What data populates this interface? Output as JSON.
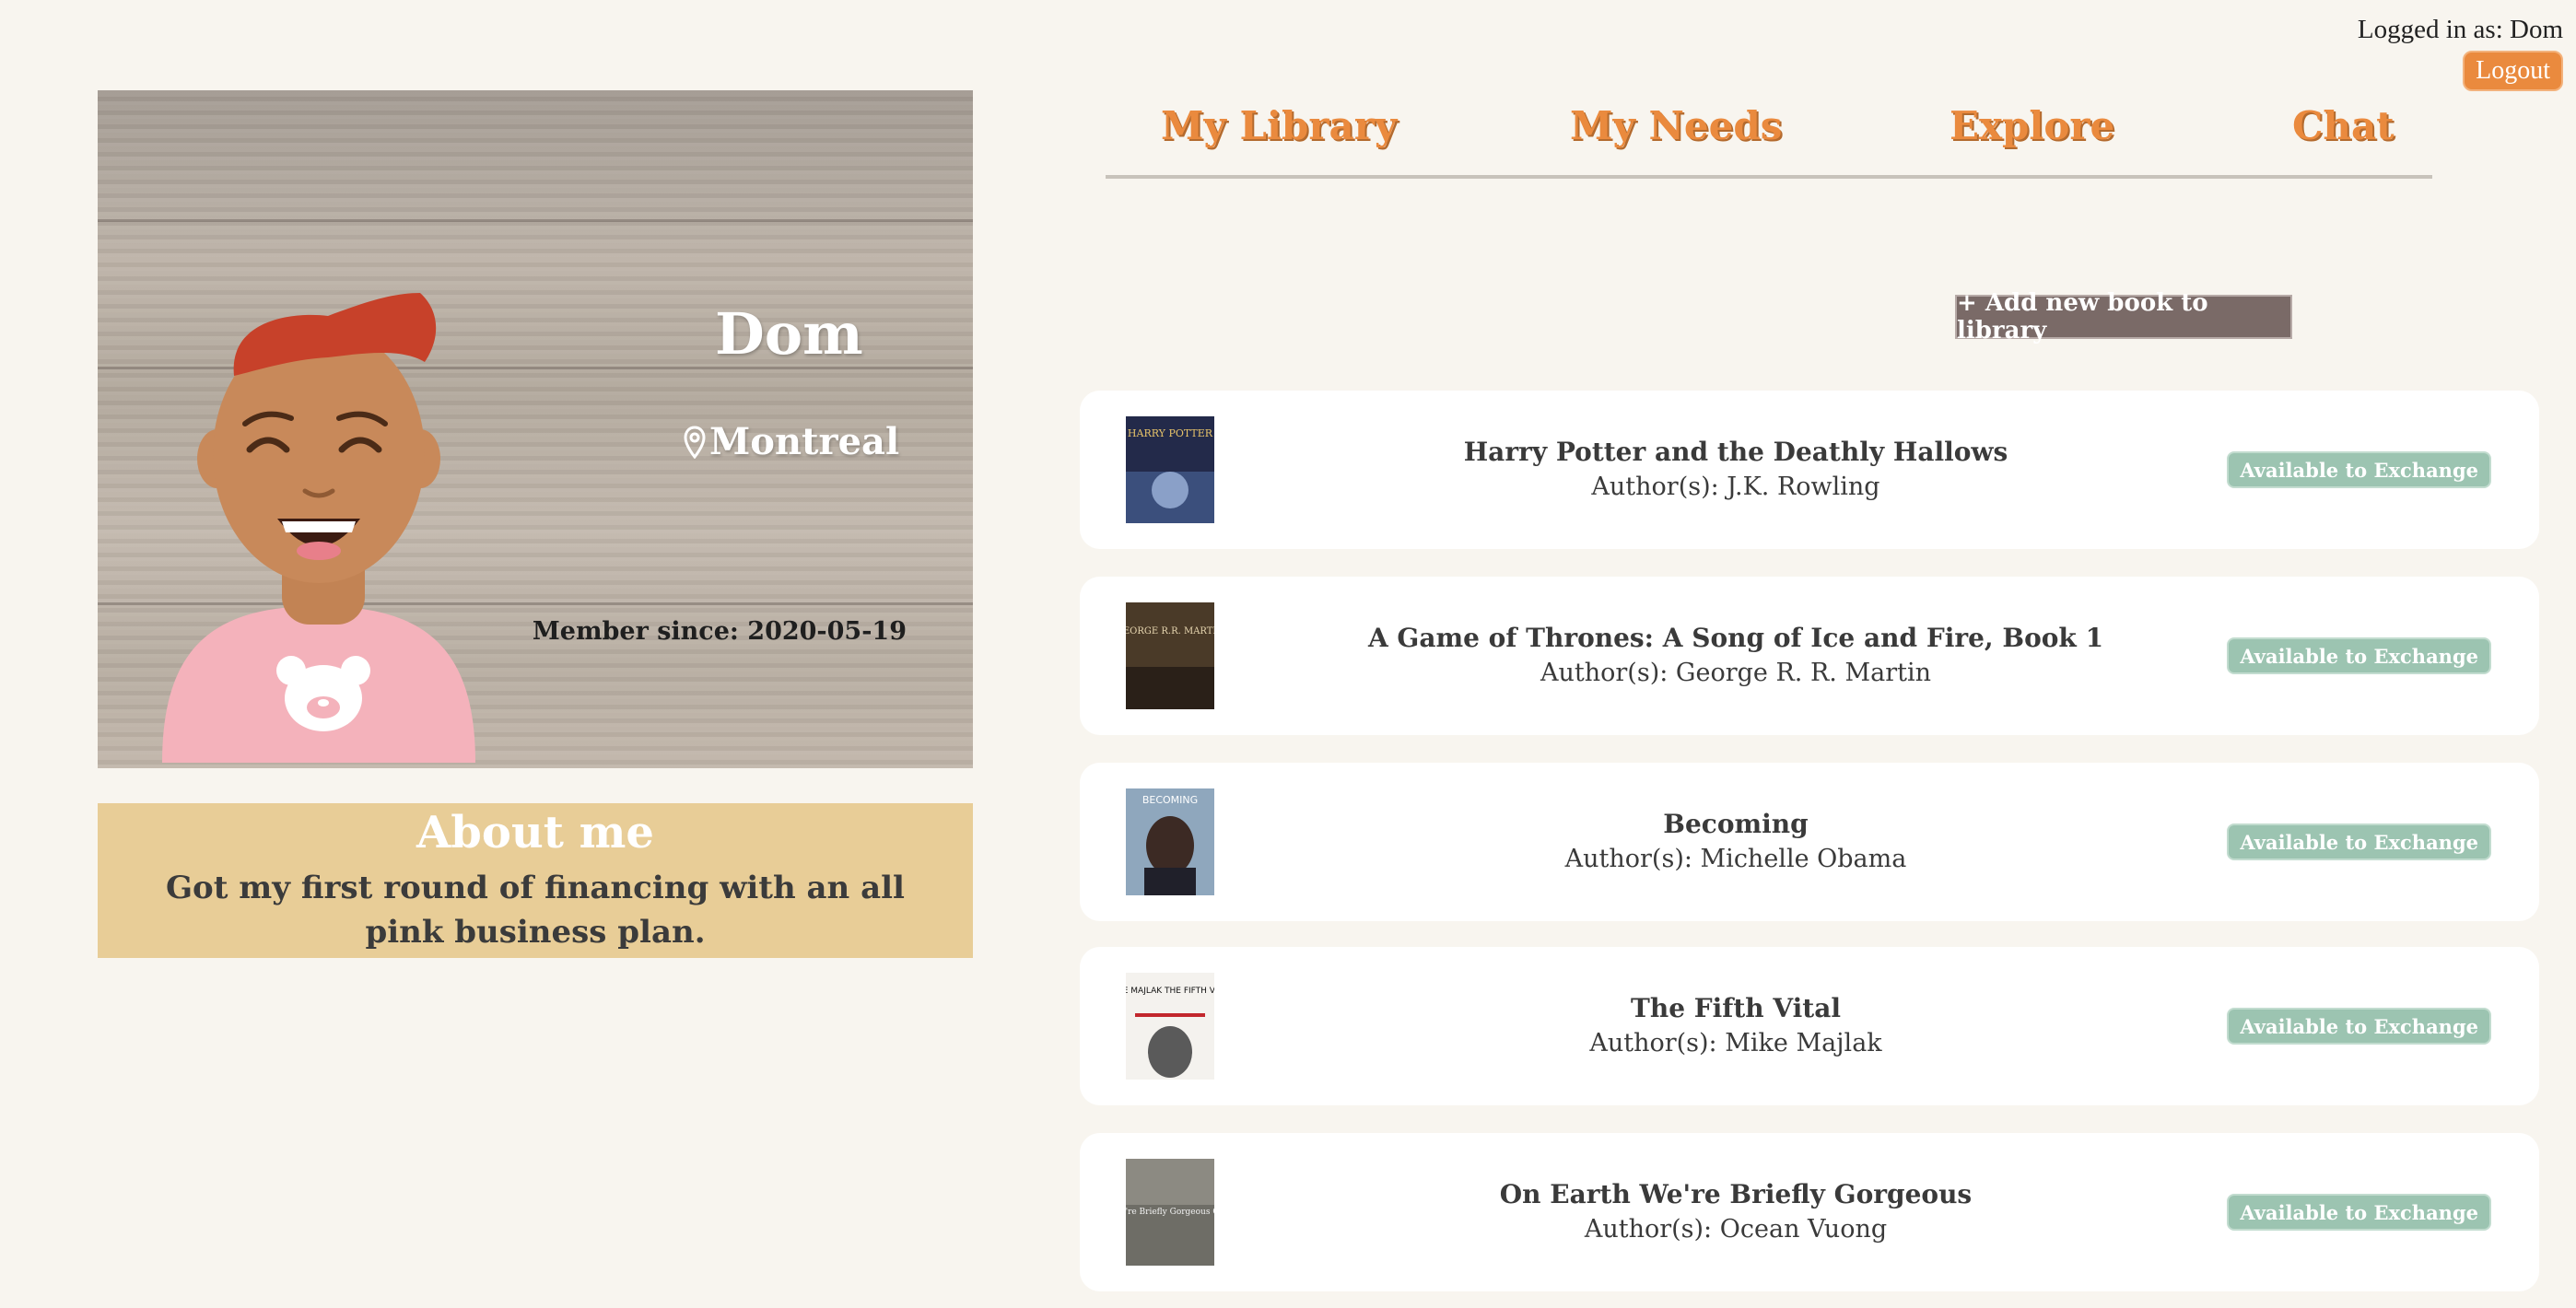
{
  "session": {
    "logged_in_text": "Logged in as: Dom",
    "logout_label": "Logout"
  },
  "profile": {
    "name": "Dom",
    "location": "Montreal",
    "member_since": "Member since: 2020-05-19"
  },
  "about": {
    "heading": "About me",
    "text": "Got my first round of financing with an all pink business plan."
  },
  "nav": {
    "tabs": [
      {
        "label": "My Library"
      },
      {
        "label": "My Needs"
      },
      {
        "label": "Explore"
      },
      {
        "label": "Chat"
      }
    ]
  },
  "library": {
    "add_label": "+ Add new book to library",
    "books": [
      {
        "title": "Harry Potter and the Deathly Hallows",
        "author": "Author(s): J.K. Rowling",
        "status": "Available to Exchange"
      },
      {
        "title": "A Game of Thrones: A Song of Ice and Fire, Book 1",
        "author": "Author(s): George R. R. Martin",
        "status": "Available to Exchange"
      },
      {
        "title": "Becoming",
        "author": "Author(s): Michelle Obama",
        "status": "Available to Exchange"
      },
      {
        "title": "The Fifth Vital",
        "author": "Author(s): Mike Majlak",
        "status": "Available to Exchange"
      },
      {
        "title": "On Earth We're Briefly Gorgeous",
        "author": "Author(s): Ocean Vuong",
        "status": "Available to Exchange"
      }
    ],
    "covers": {
      "c1": {
        "text": "HARRY POTTER"
      },
      "c2": {
        "text": "GEORGE R.R. MARTIN"
      },
      "c3": {
        "text": "BECOMING"
      },
      "c4": {
        "text": "MIKE MAJLAK THE FIFTH VITAL"
      },
      "c5": {
        "text": "On Earth We're Briefly Gorgeous Ocean Vuong"
      }
    }
  },
  "colors": {
    "accent": "#ea8a3e",
    "background": "#f8f5ef",
    "about_bg": "#e8cd97",
    "status": "#9cc4b1",
    "add_button": "#7a6a67"
  }
}
